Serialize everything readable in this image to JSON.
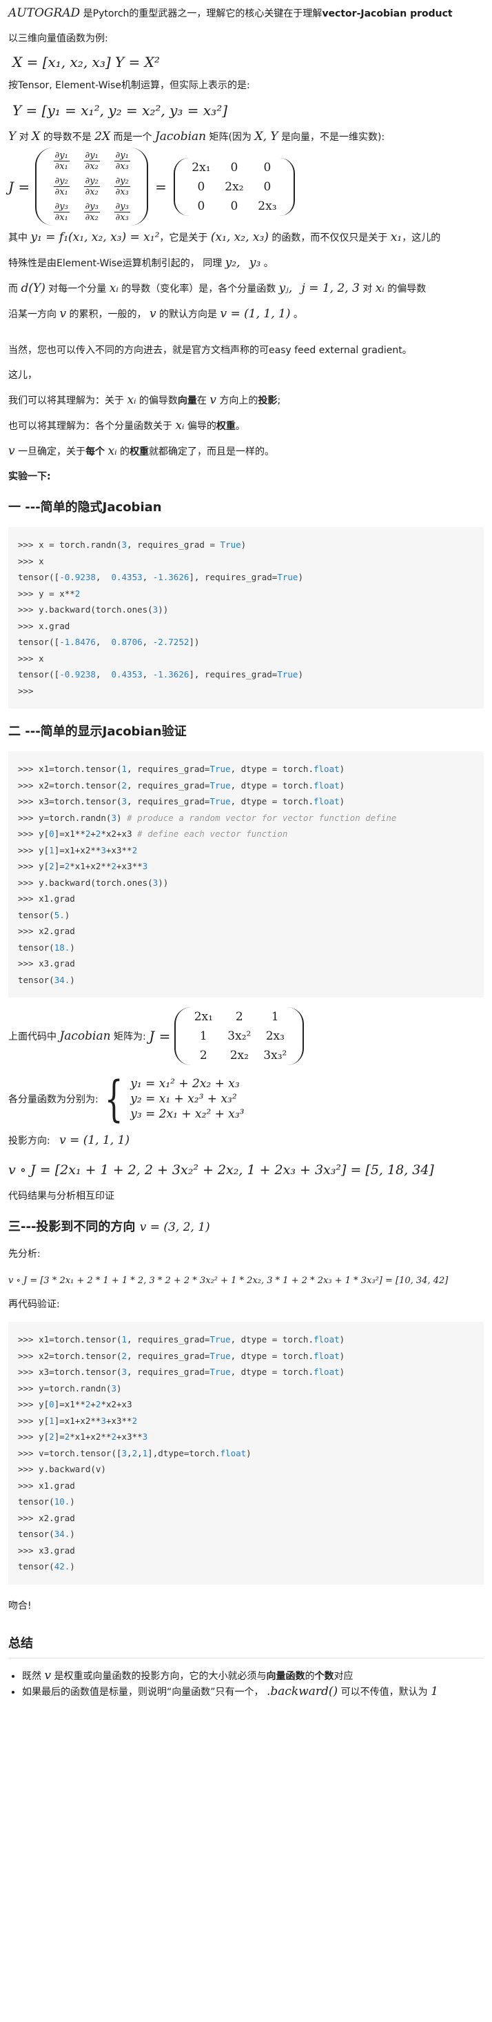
{
  "intro": {
    "autograd": "AUTOGRAD",
    "line1": "是Pytorch的重型武器之一，理解它的核心关键在于理解",
    "line1_bold": "vector-Jacobian product"
  },
  "p_vec_example": "以三维向量值函数为例:",
  "eq_xy": "X = [x₁, x₂, x₃] Y = X²",
  "p_elementwise": "按Tensor, Element-Wise机制运算，但实际上表示的是:",
  "eq_y_components": "Y = [y₁ = x₁², y₂ = x₂², y₃ = x₃²]",
  "p_derivative": {
    "a": "Y",
    "b": "对",
    "c": "X",
    "d": "的导数不是",
    "e": "2X",
    "f": "而是一个",
    "g": "Jacobian",
    "h": "矩阵(因为",
    "i": "X, Y",
    "j": "是向量，不是一维实数):"
  },
  "jacobian": {
    "lhs": "J =",
    "partials": [
      [
        "∂y₁",
        "∂x₁"
      ],
      [
        "∂y₁",
        "∂x₂"
      ],
      [
        "∂y₁",
        "∂x₃"
      ],
      [
        "∂y₂",
        "∂x₁"
      ],
      [
        "∂y₂",
        "∂x₂"
      ],
      [
        "∂y₂",
        "∂x₃"
      ],
      [
        "∂y₃",
        "∂x₁"
      ],
      [
        "∂y₃",
        "∂x₂"
      ],
      [
        "∂y₃",
        "∂x₃"
      ]
    ],
    "eq": "=",
    "values": [
      "2x₁",
      "0",
      "0",
      "0",
      "2x₂",
      "0",
      "0",
      "0",
      "2x₃"
    ]
  },
  "p_where": {
    "a": "其中",
    "eq": "y₁ = f₁(x₁, x₂, x₃) = x₁²",
    "b": "，它是关于",
    "args": "(x₁, x₂, x₃)",
    "c": "的函数，而不仅仅只是关于",
    "x1": "x₁",
    "d": "，这儿的"
  },
  "p_special": {
    "a": "特殊性是由Element-Wise运算机制引起的， 同理",
    "y2": "y₂,",
    "y3": "y₃",
    "b": "。"
  },
  "p_dy": {
    "a": "而",
    "dY": "d(Y)",
    "b": "对每一个分量",
    "xi": "xᵢ",
    "c": "的导数（变化率）是，各个分量函数",
    "yj": "yⱼ,",
    "jset": "j = 1, 2, 3",
    "d": "对",
    "xi2": "xᵢ",
    "e": "的偏导数"
  },
  "p_along": {
    "a": "沿某一方向",
    "v": "v",
    "b": "的累积，一般的，",
    "v2": "v",
    "c": "的默认方向是",
    "veq": "v = (1, 1, 1)",
    "d": "。"
  },
  "p_easyfeed": "当然，您也可以传入不同的方向进去，就是官方文档声称的可easy feed external gradient。",
  "p_here": "这儿，",
  "p_understand1": {
    "a": "我们可以将其理解为：关于",
    "xi": "xᵢ",
    "b": "的偏导数",
    "c": "向量",
    "d": "在",
    "v": "v",
    "e": "方向上的",
    "f": "投影",
    "g": ";"
  },
  "p_understand2": {
    "a": "也可以将其理解为：各个分量函数关于",
    "xi": "xᵢ",
    "b": "偏导的",
    "c": "权重",
    "d": "。"
  },
  "p_once": {
    "v": "v",
    "a": "一旦确定，关于",
    "b": "每个",
    "xi": "xᵢ",
    "c": "的",
    "d": "权重",
    "e": "就都确定了，而且是一样的。"
  },
  "p_experiment": "实验一下:",
  "h_implicit": "一 ---简单的隐式Jacobian",
  "code1": [
    [
      [
        ">>> x = torch.randn(",
        ""
      ],
      [
        "3",
        "num"
      ],
      [
        ", requires_grad = ",
        ""
      ],
      [
        "True",
        "kw"
      ],
      [
        ")",
        ""
      ]
    ],
    [
      [
        ">>> x",
        ""
      ]
    ],
    [
      [
        "tensor([",
        ""
      ],
      [
        "-0.9238",
        "num"
      ],
      [
        ",  ",
        ""
      ],
      [
        "0.4353",
        "num"
      ],
      [
        ", ",
        ""
      ],
      [
        "-1.3626",
        "num"
      ],
      [
        "], requires_grad=",
        ""
      ],
      [
        "True",
        "kw"
      ],
      [
        ")",
        ""
      ]
    ],
    [
      [
        ">>> y = x**",
        ""
      ],
      [
        "2",
        "num"
      ]
    ],
    [
      [
        ">>> y.backward(torch.ones(",
        ""
      ],
      [
        "3",
        "num"
      ],
      [
        "))",
        ""
      ]
    ],
    [
      [
        ">>> x.grad",
        ""
      ]
    ],
    [
      [
        "tensor([",
        ""
      ],
      [
        "-1.8476",
        "num"
      ],
      [
        ",  ",
        ""
      ],
      [
        "0.8706",
        "num"
      ],
      [
        ", ",
        ""
      ],
      [
        "-2.7252",
        "num"
      ],
      [
        "])",
        ""
      ]
    ],
    [
      [
        ">>> x",
        ""
      ]
    ],
    [
      [
        "tensor([",
        ""
      ],
      [
        "-0.9238",
        "num"
      ],
      [
        ",  ",
        ""
      ],
      [
        "0.4353",
        "num"
      ],
      [
        ", ",
        ""
      ],
      [
        "-1.3626",
        "num"
      ],
      [
        "], requires_grad=",
        ""
      ],
      [
        "True",
        "kw"
      ],
      [
        ")",
        ""
      ]
    ],
    [
      [
        ">>>",
        ""
      ]
    ]
  ],
  "h_explicit": "二 ---简单的显示Jacobian验证",
  "code2": [
    [
      [
        ">>> x1=torch.tensor(",
        ""
      ],
      [
        "1",
        "num"
      ],
      [
        ", requires_grad=",
        ""
      ],
      [
        "True",
        "kw"
      ],
      [
        ", dtype = torch.",
        ""
      ],
      [
        "float",
        "kw"
      ],
      [
        ")",
        ""
      ]
    ],
    [
      [
        ">>> x2=torch.tensor(",
        ""
      ],
      [
        "2",
        "num"
      ],
      [
        ", requires_grad=",
        ""
      ],
      [
        "True",
        "kw"
      ],
      [
        ", dtype = torch.",
        ""
      ],
      [
        "float",
        "kw"
      ],
      [
        ")",
        ""
      ]
    ],
    [
      [
        ">>> x3=torch.tensor(",
        ""
      ],
      [
        "3",
        "num"
      ],
      [
        ", requires_grad=",
        ""
      ],
      [
        "True",
        "kw"
      ],
      [
        ", dtype = torch.",
        ""
      ],
      [
        "float",
        "kw"
      ],
      [
        ")",
        ""
      ]
    ],
    [
      [
        ">>> y=torch.randn(",
        ""
      ],
      [
        "3",
        "num"
      ],
      [
        ") ",
        ""
      ],
      [
        "# produce a random vector for vector function define",
        "cm"
      ]
    ],
    [
      [
        ">>> y[",
        ""
      ],
      [
        "0",
        "num"
      ],
      [
        "]=x1**",
        ""
      ],
      [
        "2",
        "num"
      ],
      [
        "+",
        ""
      ],
      [
        "2",
        "num"
      ],
      [
        "*x2+x3 ",
        ""
      ],
      [
        "# define each vector function",
        "cm"
      ]
    ],
    [
      [
        ">>> y[",
        ""
      ],
      [
        "1",
        "num"
      ],
      [
        "]=x1+x2**",
        ""
      ],
      [
        "3",
        "num"
      ],
      [
        "+x3**",
        ""
      ],
      [
        "2",
        "num"
      ]
    ],
    [
      [
        ">>> y[",
        ""
      ],
      [
        "2",
        "num"
      ],
      [
        "]=",
        ""
      ],
      [
        "2",
        "num"
      ],
      [
        "*x1+x2**",
        ""
      ],
      [
        "2",
        "num"
      ],
      [
        "+x3**",
        ""
      ],
      [
        "3",
        "num"
      ]
    ],
    [
      [
        ">>> y.backward(torch.ones(",
        ""
      ],
      [
        "3",
        "num"
      ],
      [
        "))",
        ""
      ]
    ],
    [
      [
        ">>> x1.grad",
        ""
      ]
    ],
    [
      [
        "tensor(",
        ""
      ],
      [
        "5.",
        "num"
      ],
      [
        ")",
        ""
      ]
    ],
    [
      [
        ">>> x2.grad",
        ""
      ]
    ],
    [
      [
        "tensor(",
        ""
      ],
      [
        "18.",
        "num"
      ],
      [
        ")",
        ""
      ]
    ],
    [
      [
        ">>> x3.grad",
        ""
      ]
    ],
    [
      [
        "tensor(",
        ""
      ],
      [
        "34.",
        "num"
      ],
      [
        ")",
        ""
      ]
    ]
  ],
  "p_jac_above": {
    "a": "上面代码中",
    "jac": "Jacobian",
    "b": "矩阵为:",
    "lhs": "J =",
    "cells": [
      "2x₁",
      "2",
      "1",
      "1",
      "3x₂²",
      "2x₃",
      "2",
      "2x₂",
      "3x₃²"
    ]
  },
  "p_components": {
    "a": "各分量函数为分别为:",
    "eqs": [
      "y₁ = x₁² + 2x₂ + x₃",
      "y₂ = x₁ + x₂³ + x₃²",
      "y₃ = 2x₁ + x₂² + x₃³"
    ]
  },
  "p_proj_dir": {
    "a": "投影方向:",
    "veq": "v = (1, 1, 1)"
  },
  "eq_voj1": "v ∘ J = [2x₁ + 1 + 2, 2 + 3x₂² + 2x₂, 1 + 2x₃ + 3x₃²] = [5, 18, 34]",
  "p_code_match": "代码结果与分析相互印证",
  "h_proj": {
    "a": "三---投影到不同的方向",
    "veq": "v = (3, 2, 1)"
  },
  "p_analysis": "先分析:",
  "eq_voj2": "v ∘ J = [3 * 2x₁ + 2 * 1 + 1 * 2, 3 * 2 + 2 * 3x₂² + 1 * 2x₂, 3 * 1 + 2 * 2x₃ + 1 * 3x₃²] = [10, 34, 42]",
  "p_verify": "再代码验证:",
  "code3": [
    [
      [
        ">>> x1=torch.tensor(",
        ""
      ],
      [
        "1",
        "num"
      ],
      [
        ", requires_grad=",
        ""
      ],
      [
        "True",
        "kw"
      ],
      [
        ", dtype = torch.",
        ""
      ],
      [
        "float",
        "kw"
      ],
      [
        ")",
        ""
      ]
    ],
    [
      [
        ">>> x2=torch.tensor(",
        ""
      ],
      [
        "2",
        "num"
      ],
      [
        ", requires_grad=",
        ""
      ],
      [
        "True",
        "kw"
      ],
      [
        ", dtype = torch.",
        ""
      ],
      [
        "float",
        "kw"
      ],
      [
        ")",
        ""
      ]
    ],
    [
      [
        ">>> x3=torch.tensor(",
        ""
      ],
      [
        "3",
        "num"
      ],
      [
        ", requires_grad=",
        ""
      ],
      [
        "True",
        "kw"
      ],
      [
        ", dtype = torch.",
        ""
      ],
      [
        "float",
        "kw"
      ],
      [
        ")",
        ""
      ]
    ],
    [
      [
        ">>> y=torch.randn(",
        ""
      ],
      [
        "3",
        "num"
      ],
      [
        ")",
        ""
      ]
    ],
    [
      [
        ">>> y[",
        ""
      ],
      [
        "0",
        "num"
      ],
      [
        "]=x1**",
        ""
      ],
      [
        "2",
        "num"
      ],
      [
        "+",
        ""
      ],
      [
        "2",
        "num"
      ],
      [
        "*x2+x3",
        ""
      ]
    ],
    [
      [
        ">>> y[",
        ""
      ],
      [
        "1",
        "num"
      ],
      [
        "]=x1+x2**",
        ""
      ],
      [
        "3",
        "num"
      ],
      [
        "+x3**",
        ""
      ],
      [
        "2",
        "num"
      ]
    ],
    [
      [
        ">>> y[",
        ""
      ],
      [
        "2",
        "num"
      ],
      [
        "]=",
        ""
      ],
      [
        "2",
        "num"
      ],
      [
        "*x1+x2**",
        ""
      ],
      [
        "2",
        "num"
      ],
      [
        "+x3**",
        ""
      ],
      [
        "3",
        "num"
      ]
    ],
    [
      [
        ">>> v=torch.tensor([",
        ""
      ],
      [
        "3",
        "num"
      ],
      [
        ",",
        ""
      ],
      [
        "2",
        "num"
      ],
      [
        ",",
        ""
      ],
      [
        "1",
        "num"
      ],
      [
        "],dtype=torch.",
        ""
      ],
      [
        "float",
        "kw"
      ],
      [
        ")",
        ""
      ]
    ],
    [
      [
        ">>> y.backward(v)",
        ""
      ]
    ],
    [
      [
        ">>> x1.grad",
        ""
      ]
    ],
    [
      [
        "tensor(",
        ""
      ],
      [
        "10.",
        "num"
      ],
      [
        ")",
        ""
      ]
    ],
    [
      [
        ">>> x2.grad",
        ""
      ]
    ],
    [
      [
        "tensor(",
        ""
      ],
      [
        "34.",
        "num"
      ],
      [
        ")",
        ""
      ]
    ],
    [
      [
        ">>> x3.grad",
        ""
      ]
    ],
    [
      [
        "tensor(",
        ""
      ],
      [
        "42.",
        "num"
      ],
      [
        ")",
        ""
      ]
    ]
  ],
  "p_match": "吻合!",
  "h_summary": "总结",
  "summary": {
    "li1": {
      "a": "既然",
      "v": "v",
      "b": "是权重或向量函数的投影方向，它的大小就必须与",
      "c": "向量函数",
      "d": "的",
      "e": "个数",
      "f": "对应"
    },
    "li2": {
      "a": "如果最后的函数值是标量，则说明“向量函数”只有一个，",
      "bw": ".backward()",
      "b": "可以不传值，默认为",
      "one": "1"
    }
  }
}
